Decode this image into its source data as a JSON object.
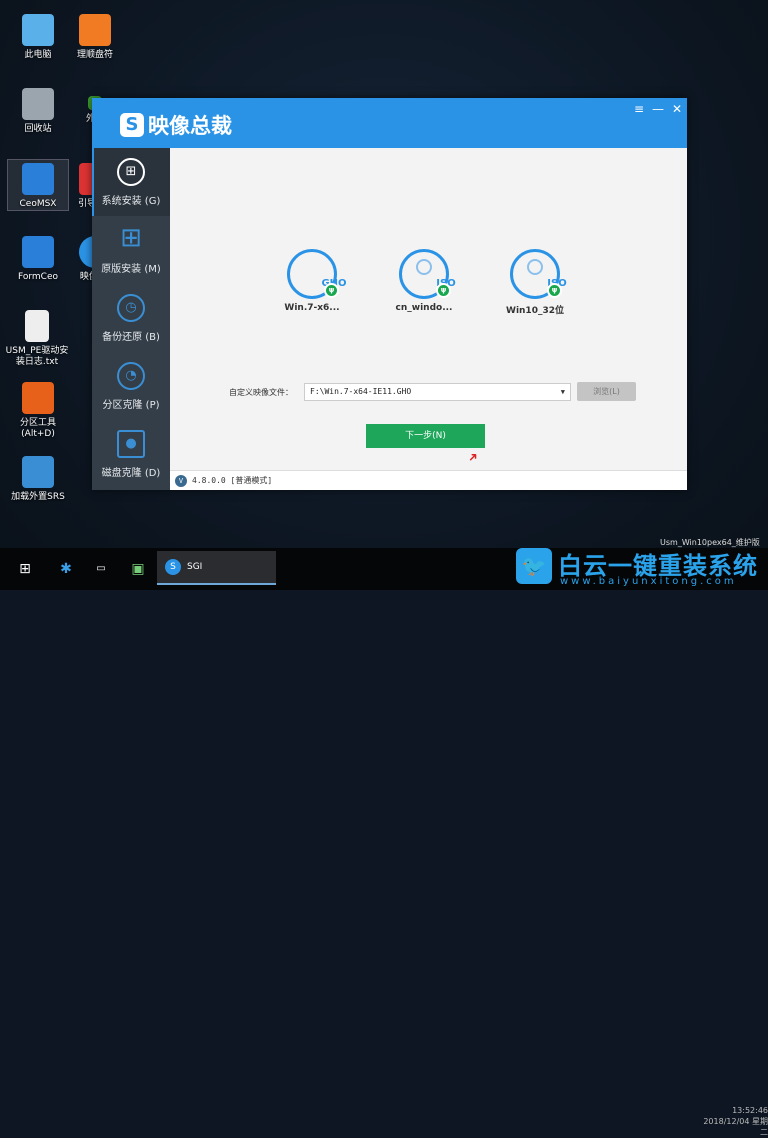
{
  "desktop": {
    "icons": [
      {
        "label": "此电脑",
        "color": "#5ab0e8"
      },
      {
        "label": "理顺盘符",
        "color": "#f07b22"
      },
      {
        "label": "回收站",
        "color": "#9aa5ae"
      },
      {
        "label": "外置",
        "color": "#3a9a30"
      },
      {
        "label": "CeoMSX",
        "color": "#2a7fd8"
      },
      {
        "label": "引导(Alt",
        "color": "#d33"
      },
      {
        "label": "FormCeo",
        "color": "#2a7fd8"
      },
      {
        "label": "映像(Al",
        "color": "#2b93e6"
      },
      {
        "label": "USM_PE驱动安装日志.txt",
        "color": "#eeeeee"
      },
      {
        "label": "分区工具(Alt+D)",
        "color": "#e8611a"
      },
      {
        "label": "加载外置SRS",
        "color": "#3a8fd4"
      }
    ]
  },
  "window": {
    "title": "映像总裁",
    "controls": [
      "≡",
      "—",
      "✕"
    ],
    "sidebar": [
      {
        "label": "系统安装 (G)",
        "icon": "windows-circle-icon",
        "active": true
      },
      {
        "label": "原版安装 (M)",
        "icon": "windows-logo-icon"
      },
      {
        "label": "备份还原 (B)",
        "icon": "clock-restore-icon"
      },
      {
        "label": "分区克隆 (P)",
        "icon": "pie-chart-icon"
      },
      {
        "label": "磁盘克隆 (D)",
        "icon": "disk-clone-icon"
      }
    ],
    "images": [
      {
        "type": "GHO",
        "name": "Win.7-x6..."
      },
      {
        "type": "ISO",
        "name": "cn_windo..."
      },
      {
        "type": "ISO",
        "name": "Win10_32位"
      }
    ],
    "custom_label": "自定义映像文件：",
    "custom_value": "F:\\Win.7-x64-IE11.GHO",
    "browse_label": "浏览(L)",
    "next_label": "下一步(N)",
    "version": "4.8.0.0 [普通模式]"
  },
  "taskbar": {
    "active_app": "SGI"
  },
  "sysinfo": "Usm_Win10pex64_维护版",
  "clock": {
    "time": "13:52:46",
    "date": "2018/12/04 星期二"
  },
  "watermark": {
    "title": "白云一键重装系统",
    "url": "www.baiyunxitong.com"
  },
  "colors": {
    "accent": "#2b93e6",
    "next_button": "#1ea75a",
    "sidebar": "#333e48"
  }
}
